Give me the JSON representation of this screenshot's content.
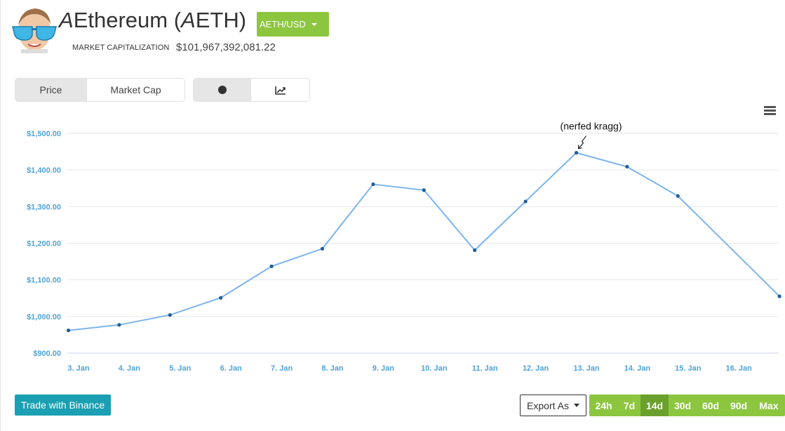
{
  "header": {
    "title_prefix": "A",
    "title_main": "Ethereum (",
    "title_mid": "A",
    "title_end": "ETH)",
    "pair_selector": "AETH/USD",
    "market_cap_label": "MARKET CAPITALIZATION",
    "market_cap_value": "$101,967,392,081.22"
  },
  "toggles": {
    "metric": [
      "Price",
      "Market Cap"
    ],
    "metric_active": "Price",
    "style_icons": [
      "dot-icon",
      "line-chart-icon"
    ],
    "style_active": "dot-icon"
  },
  "colors": {
    "accent_green": "#8cc63f",
    "accent_green_active": "#6aa12c",
    "line": "#7cb5ec",
    "point": "#1f5f99",
    "axis_labels": "#4fa3d6",
    "trade_button": "#1aa0b2"
  },
  "chart_data": {
    "type": "line",
    "x": [
      "3. Jan",
      "4. Jan",
      "5. Jan",
      "6. Jan",
      "7. Jan",
      "8. Jan",
      "9. Jan",
      "10. Jan",
      "11. Jan",
      "12. Jan",
      "13. Jan",
      "14. Jan",
      "15. Jan",
      "16. Jan"
    ],
    "series": [
      {
        "points": [
          {
            "x": 2.8,
            "y": 962
          },
          {
            "x": 3.8,
            "y": 977
          },
          {
            "x": 4.8,
            "y": 1004
          },
          {
            "x": 5.8,
            "y": 1051
          },
          {
            "x": 6.8,
            "y": 1137
          },
          {
            "x": 7.8,
            "y": 1185
          },
          {
            "x": 8.8,
            "y": 1361
          },
          {
            "x": 9.8,
            "y": 1345
          },
          {
            "x": 10.8,
            "y": 1181
          },
          {
            "x": 11.8,
            "y": 1314
          },
          {
            "x": 12.8,
            "y": 1447
          },
          {
            "x": 13.8,
            "y": 1409
          },
          {
            "x": 14.8,
            "y": 1329
          },
          {
            "x": 16.8,
            "y": 1055
          }
        ]
      }
    ],
    "x_first_label_value": 3,
    "yticks": [
      "$900.00",
      "$1,000.00",
      "$1,100.00",
      "$1,200.00",
      "$1,300.00",
      "$1,400.00",
      "$1,500.00"
    ],
    "ytick_values": [
      900,
      1000,
      1100,
      1200,
      1300,
      1400,
      1500
    ],
    "ylim": [
      900,
      1500
    ],
    "annotation": {
      "text": "(nerfed kragg)",
      "point_index": 10
    },
    "grid": true
  },
  "footer": {
    "trade_button": "Trade with Binance",
    "export_label": "Export As",
    "ranges": [
      "24h",
      "7d",
      "14d",
      "30d",
      "60d",
      "90d",
      "Max"
    ],
    "range_active": "14d"
  }
}
